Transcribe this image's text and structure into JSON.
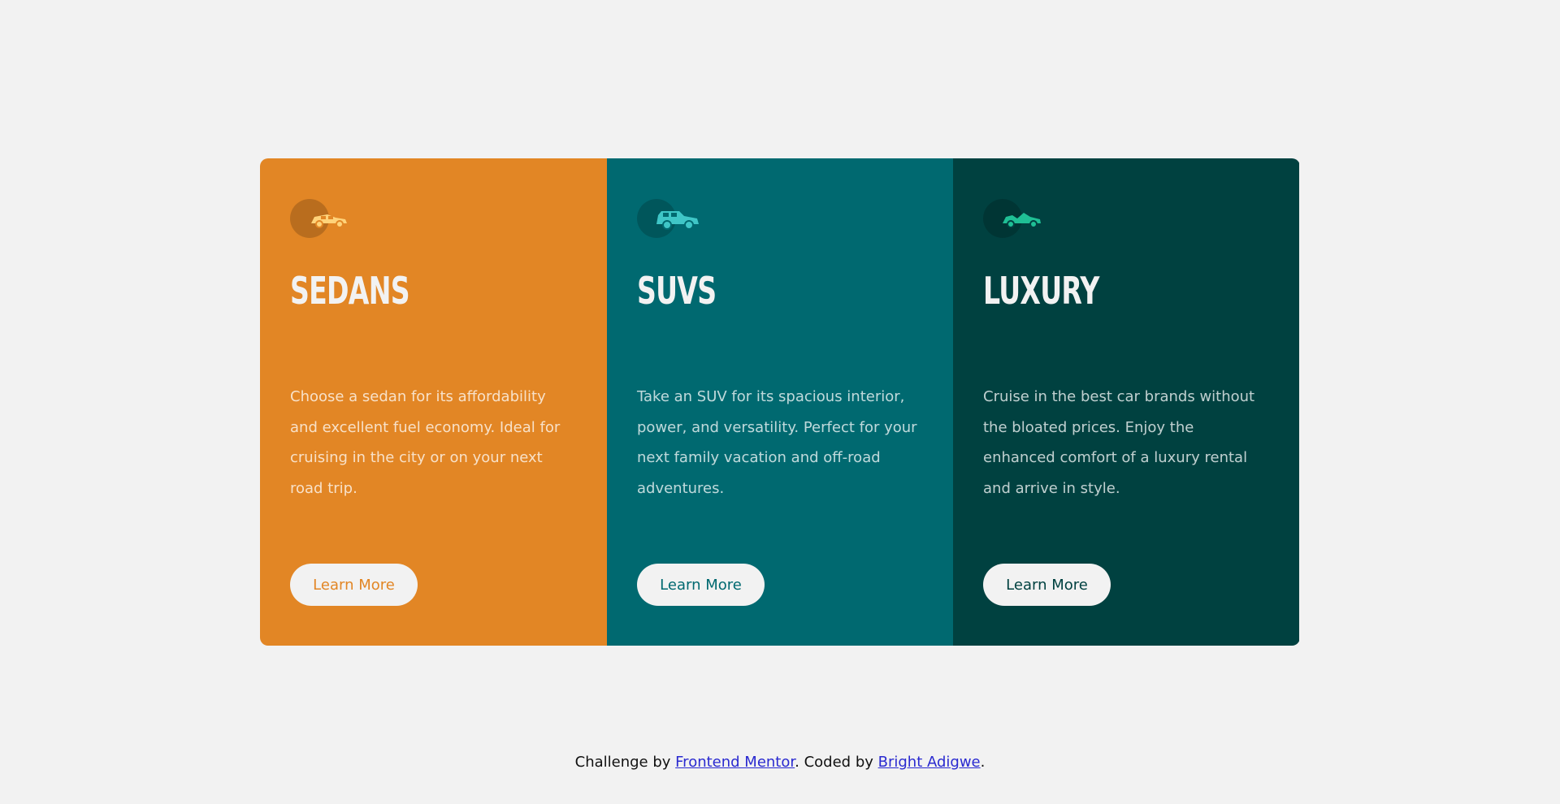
{
  "cards": [
    {
      "icon": "sedan-car-icon",
      "title": "SEDANS",
      "text": "Choose a sedan for its affordability and excellent fuel economy. Ideal for cruising in the city or on your next road trip.",
      "button": "Learn More",
      "bg_color": "#e28625",
      "accent_color": "#e28625",
      "icon_color": "#ffd37a"
    },
    {
      "icon": "suv-car-icon",
      "title": "SUVS",
      "text": "Take an SUV for its spacious interior, power, and versatility. Perfect for your next family vacation and off-road adventures.",
      "button": "Learn More",
      "bg_color": "#006970",
      "accent_color": "#006970",
      "icon_color": "#3fc6c7"
    },
    {
      "icon": "luxury-car-icon",
      "title": "LUXURY",
      "text": "Cruise in the best car brands without the bloated prices. Enjoy the enhanced comfort of a luxury rental and arrive in style.",
      "button": "Learn More",
      "bg_color": "#004140",
      "accent_color": "#004140",
      "icon_color": "#1fbf95"
    }
  ],
  "footer": {
    "prefix": "Challenge by ",
    "link1": "Frontend Mentor",
    "middle": ". Coded by ",
    "link2": "Bright Adigwe",
    "suffix": "."
  }
}
